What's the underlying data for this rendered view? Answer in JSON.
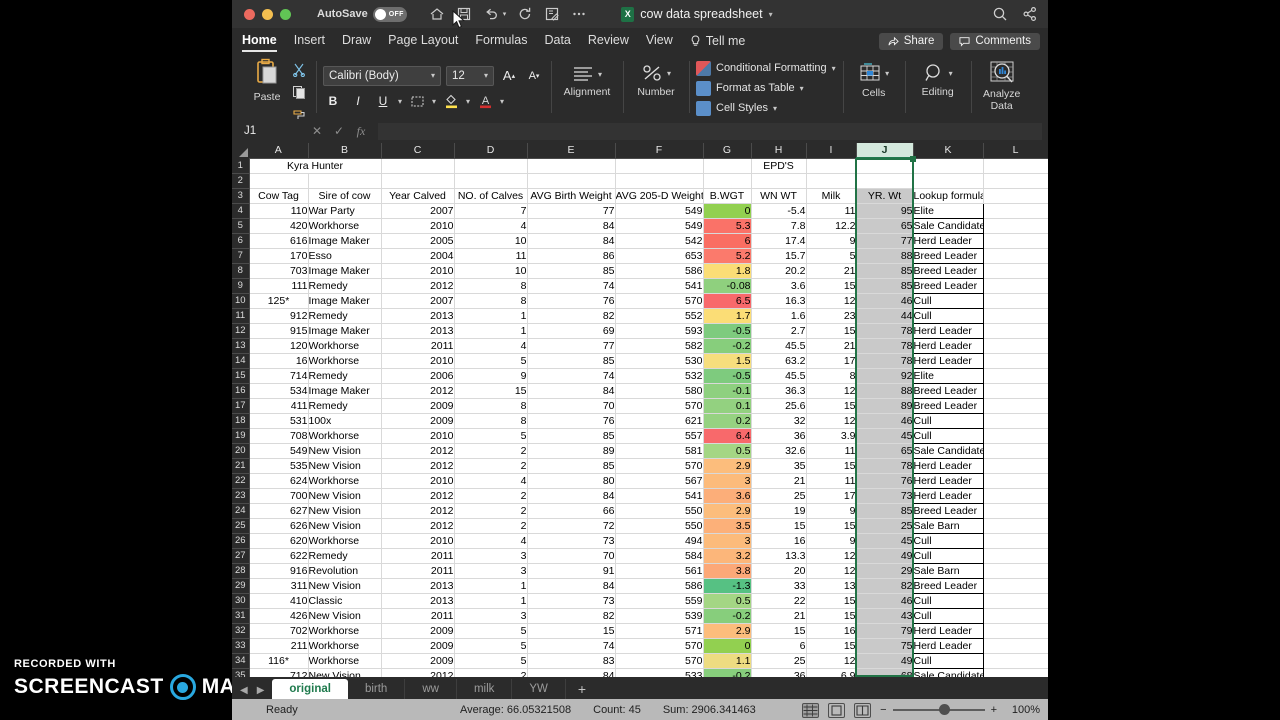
{
  "watermark": {
    "top": "RECORDED WITH",
    "word1": "SCREENCAST",
    "word2": "MATIC"
  },
  "titlebar": {
    "autosave_label": "AutoSave",
    "autosave_state": "OFF",
    "document_name": "cow data spreadsheet",
    "icons": [
      "home-icon",
      "save-icon",
      "undo-icon",
      "redo-icon",
      "new-comment-icon",
      "more-icon",
      "search-icon",
      "share-user-icon"
    ]
  },
  "menubar": {
    "items": [
      "Home",
      "Insert",
      "Draw",
      "Page Layout",
      "Formulas",
      "Data",
      "Review",
      "View"
    ],
    "active": "Home",
    "tell_me": "Tell me",
    "share_label": "Share",
    "comments_label": "Comments"
  },
  "ribbon": {
    "paste_label": "Paste",
    "font_name": "Calibri (Body)",
    "font_size": "12",
    "grow_font": "A",
    "shrink_font": "A",
    "bold": "B",
    "italic": "I",
    "underline": "U",
    "alignment_label": "Alignment",
    "number_label": "Number",
    "conditional_formatting": "Conditional Formatting",
    "format_as_table": "Format as Table",
    "cell_styles": "Cell Styles",
    "cells_label": "Cells",
    "editing_label": "Editing",
    "analyze_data_label": "Analyze Data"
  },
  "formula_bar": {
    "name_box": "J1",
    "formula": ""
  },
  "grid": {
    "columns": [
      "A",
      "B",
      "C",
      "D",
      "E",
      "F",
      "G",
      "H",
      "I",
      "J",
      "K",
      "L"
    ],
    "selected_column": "J",
    "row1": {
      "a": "Kyra Hunter",
      "h": "EPD'S"
    },
    "headers": [
      "Cow Tag",
      "Sire of cow",
      "Year Calved",
      "NO. of Calves",
      "AVG Birth Weight",
      "AVG 205-D Weight",
      "B.WGT",
      "WN WT",
      "Milk",
      "YR. Wt",
      "Lookup formula"
    ],
    "rows": [
      {
        "n": 4,
        "tag": "110",
        "sire": "War Party",
        "year": "2007",
        "calves": "7",
        "bw": "77",
        "w205": "549",
        "bwgt": "0",
        "wn": "-5.4",
        "milk": "11",
        "yr": "95",
        "lookup": "Elite",
        "c": "#92d050"
      },
      {
        "n": 5,
        "tag": "420",
        "sire": "Workhorse",
        "year": "2010",
        "calves": "4",
        "bw": "84",
        "w205": "549",
        "bwgt": "5.3",
        "wn": "7.8",
        "milk": "12.2",
        "yr": "65",
        "lookup": "Sale Candidate",
        "c": "#fa7268"
      },
      {
        "n": 6,
        "tag": "616",
        "sire": "Image Maker",
        "year": "2005",
        "calves": "10",
        "bw": "84",
        "w205": "542",
        "bwgt": "6",
        "wn": "17.4",
        "milk": "9",
        "yr": "77",
        "lookup": "Herd Leader",
        "c": "#fa6e62"
      },
      {
        "n": 7,
        "tag": "170",
        "sire": "Esso",
        "year": "2004",
        "calves": "11",
        "bw": "86",
        "w205": "653",
        "bwgt": "5.2",
        "wn": "15.7",
        "milk": "5",
        "yr": "88",
        "lookup": "Breed Leader",
        "c": "#fb7a6c"
      },
      {
        "n": 8,
        "tag": "703",
        "sire": "Image Maker",
        "year": "2010",
        "calves": "10",
        "bw": "85",
        "w205": "586",
        "bwgt": "1.8",
        "wn": "20.2",
        "milk": "21",
        "yr": "85",
        "lookup": "Breed Leader",
        "c": "#fbdd76"
      },
      {
        "n": 9,
        "tag": "111",
        "sire": "Remedy",
        "year": "2012",
        "calves": "8",
        "bw": "74",
        "w205": "541",
        "bwgt": "-0.08",
        "wn": "3.6",
        "milk": "15",
        "yr": "85",
        "lookup": "Breed Leader",
        "c": "#8fd07e"
      },
      {
        "n": 10,
        "tag": "125*",
        "sire": "Image Maker",
        "year": "2007",
        "calves": "8",
        "bw": "76",
        "w205": "570",
        "bwgt": "6.5",
        "wn": "16.3",
        "milk": "12",
        "yr": "46",
        "lookup": "Cull",
        "c": "#f8696b"
      },
      {
        "n": 11,
        "tag": "912",
        "sire": "Remedy",
        "year": "2013",
        "calves": "1",
        "bw": "82",
        "w205": "552",
        "bwgt": "1.7",
        "wn": "1.6",
        "milk": "23",
        "yr": "44",
        "lookup": "Cull",
        "c": "#fbdd76"
      },
      {
        "n": 12,
        "tag": "915",
        "sire": "Image Maker",
        "year": "2013",
        "calves": "1",
        "bw": "69",
        "w205": "593",
        "bwgt": "-0.5",
        "wn": "2.7",
        "milk": "15",
        "yr": "78",
        "lookup": "Herd Leader",
        "c": "#7ecb7e"
      },
      {
        "n": 13,
        "tag": "120",
        "sire": "Workhorse",
        "year": "2011",
        "calves": "4",
        "bw": "77",
        "w205": "582",
        "bwgt": "-0.2",
        "wn": "45.5",
        "milk": "21",
        "yr": "78",
        "lookup": "Herd Leader",
        "c": "#87ce7c"
      },
      {
        "n": 14,
        "tag": "16",
        "sire": "Workhorse",
        "year": "2010",
        "calves": "5",
        "bw": "85",
        "w205": "530",
        "bwgt": "1.5",
        "wn": "63.2",
        "milk": "17",
        "yr": "78",
        "lookup": "Herd Leader",
        "c": "#f6de7d"
      },
      {
        "n": 15,
        "tag": "714",
        "sire": "Remedy",
        "year": "2006",
        "calves": "9",
        "bw": "74",
        "w205": "532",
        "bwgt": "-0.5",
        "wn": "45.5",
        "milk": "8",
        "yr": "92",
        "lookup": "Elite",
        "c": "#7ecb7e"
      },
      {
        "n": 16,
        "tag": "534",
        "sire": "Image Maker",
        "year": "2012",
        "calves": "15",
        "bw": "84",
        "w205": "580",
        "bwgt": "-0.1",
        "wn": "36.3",
        "milk": "12",
        "yr": "88",
        "lookup": "Breed Leader",
        "c": "#8ed07f"
      },
      {
        "n": 17,
        "tag": "411",
        "sire": "Remedy",
        "year": "2009",
        "calves": "8",
        "bw": "70",
        "w205": "570",
        "bwgt": "0.1",
        "wn": "25.6",
        "milk": "15",
        "yr": "89",
        "lookup": "Breed Leader",
        "c": "#93d180"
      },
      {
        "n": 18,
        "tag": "531",
        "sire": "100x",
        "year": "2009",
        "calves": "8",
        "bw": "76",
        "w205": "621",
        "bwgt": "0.2",
        "wn": "32",
        "milk": "12",
        "yr": "46",
        "lookup": "Cull",
        "c": "#96d281"
      },
      {
        "n": 19,
        "tag": "708",
        "sire": "Workhorse",
        "year": "2010",
        "calves": "5",
        "bw": "85",
        "w205": "557",
        "bwgt": "6.4",
        "wn": "36",
        "milk": "3.9",
        "yr": "45",
        "lookup": "Cull",
        "c": "#f8696b"
      },
      {
        "n": 20,
        "tag": "549",
        "sire": "New Vision",
        "year": "2012",
        "calves": "2",
        "bw": "89",
        "w205": "581",
        "bwgt": "0.5",
        "wn": "32.6",
        "milk": "11",
        "yr": "65",
        "lookup": "Sale Candidate",
        "c": "#a4d684"
      },
      {
        "n": 21,
        "tag": "535",
        "sire": "New Vision",
        "year": "2012",
        "calves": "2",
        "bw": "85",
        "w205": "570",
        "bwgt": "2.9",
        "wn": "35",
        "milk": "15",
        "yr": "78",
        "lookup": "Herd Leader",
        "c": "#fcbd7c"
      },
      {
        "n": 22,
        "tag": "624",
        "sire": "Workhorse",
        "year": "2010",
        "calves": "4",
        "bw": "80",
        "w205": "567",
        "bwgt": "3",
        "wn": "21",
        "milk": "11",
        "yr": "76",
        "lookup": "Herd Leader",
        "c": "#fcbb7b"
      },
      {
        "n": 23,
        "tag": "700",
        "sire": "New Vision",
        "year": "2012",
        "calves": "2",
        "bw": "84",
        "w205": "541",
        "bwgt": "3.6",
        "wn": "25",
        "milk": "17",
        "yr": "73",
        "lookup": "Herd Leader",
        "c": "#fcae79"
      },
      {
        "n": 24,
        "tag": "627",
        "sire": "New Vision",
        "year": "2012",
        "calves": "2",
        "bw": "66",
        "w205": "550",
        "bwgt": "2.9",
        "wn": "19",
        "milk": "9",
        "yr": "85",
        "lookup": "Breed Leader",
        "c": "#fcbd7c"
      },
      {
        "n": 25,
        "tag": "626",
        "sire": "New Vision",
        "year": "2012",
        "calves": "2",
        "bw": "72",
        "w205": "550",
        "bwgt": "3.5",
        "wn": "15",
        "milk": "15",
        "yr": "25",
        "lookup": "Sale Barn",
        "c": "#fcb079"
      },
      {
        "n": 26,
        "tag": "620",
        "sire": "Workhorse",
        "year": "2010",
        "calves": "4",
        "bw": "73",
        "w205": "494",
        "bwgt": "3",
        "wn": "16",
        "milk": "9",
        "yr": "45",
        "lookup": "Cull",
        "c": "#fcbb7b"
      },
      {
        "n": 27,
        "tag": "622",
        "sire": "Remedy",
        "year": "2011",
        "calves": "3",
        "bw": "70",
        "w205": "584",
        "bwgt": "3.2",
        "wn": "13.3",
        "milk": "12",
        "yr": "49",
        "lookup": "Cull",
        "c": "#fcb67a"
      },
      {
        "n": 28,
        "tag": "916",
        "sire": "Revolution",
        "year": "2011",
        "calves": "3",
        "bw": "91",
        "w205": "561",
        "bwgt": "3.8",
        "wn": "20",
        "milk": "12",
        "yr": "29",
        "lookup": "Sale Barn",
        "c": "#fca878"
      },
      {
        "n": 29,
        "tag": "311",
        "sire": "New Vision",
        "year": "2013",
        "calves": "1",
        "bw": "84",
        "w205": "586",
        "bwgt": "-1.3",
        "wn": "33",
        "milk": "13",
        "yr": "82",
        "lookup": "Breed Leader",
        "c": "#56c183"
      },
      {
        "n": 30,
        "tag": "410",
        "sire": "Classic",
        "year": "2013",
        "calves": "1",
        "bw": "73",
        "w205": "559",
        "bwgt": "0.5",
        "wn": "22",
        "milk": "15",
        "yr": "46",
        "lookup": "Cull",
        "c": "#a4d684"
      },
      {
        "n": 31,
        "tag": "426",
        "sire": "New Vision",
        "year": "2011",
        "calves": "3",
        "bw": "82",
        "w205": "539",
        "bwgt": "-0.2",
        "wn": "21",
        "milk": "15",
        "yr": "43",
        "lookup": "Cull",
        "c": "#87ce7c"
      },
      {
        "n": 32,
        "tag": "702",
        "sire": "Workhorse",
        "year": "2009",
        "calves": "5",
        "bw": "15",
        "w205": "571",
        "bwgt": "2.9",
        "wn": "15",
        "milk": "16",
        "yr": "79",
        "lookup": "Herd Leader",
        "c": "#fcbd7c"
      },
      {
        "n": 33,
        "tag": "211",
        "sire": "Workhorse",
        "year": "2009",
        "calves": "5",
        "bw": "74",
        "w205": "570",
        "bwgt": "0",
        "wn": "6",
        "milk": "15",
        "yr": "75",
        "lookup": "Herd Leader",
        "c": "#92d050"
      },
      {
        "n": 34,
        "tag": "116*",
        "sire": "Workhorse",
        "year": "2009",
        "calves": "5",
        "bw": "83",
        "w205": "570",
        "bwgt": "1.1",
        "wn": "25",
        "milk": "12",
        "yr": "49",
        "lookup": "Cull",
        "c": "#eddc81"
      },
      {
        "n": 35,
        "tag": "712",
        "sire": "New Vision",
        "year": "2012",
        "calves": "2",
        "bw": "84",
        "w205": "533",
        "bwgt": "-0.2",
        "wn": "36",
        "milk": "6.9",
        "yr": "68",
        "lookup": "Sale Candidate",
        "c": "#87ce7c"
      }
    ]
  },
  "sheet_tabs": {
    "tabs": [
      "original",
      "birth",
      "ww",
      "milk",
      "YW"
    ],
    "active": "original",
    "add_label": "+"
  },
  "status_bar": {
    "ready": "Ready",
    "average": "Average: 66.05321508",
    "count": "Count: 45",
    "sum": "Sum: 2906.341463",
    "zoom": "100%",
    "views": [
      "normal-view",
      "page-layout-view",
      "page-break-view"
    ]
  }
}
